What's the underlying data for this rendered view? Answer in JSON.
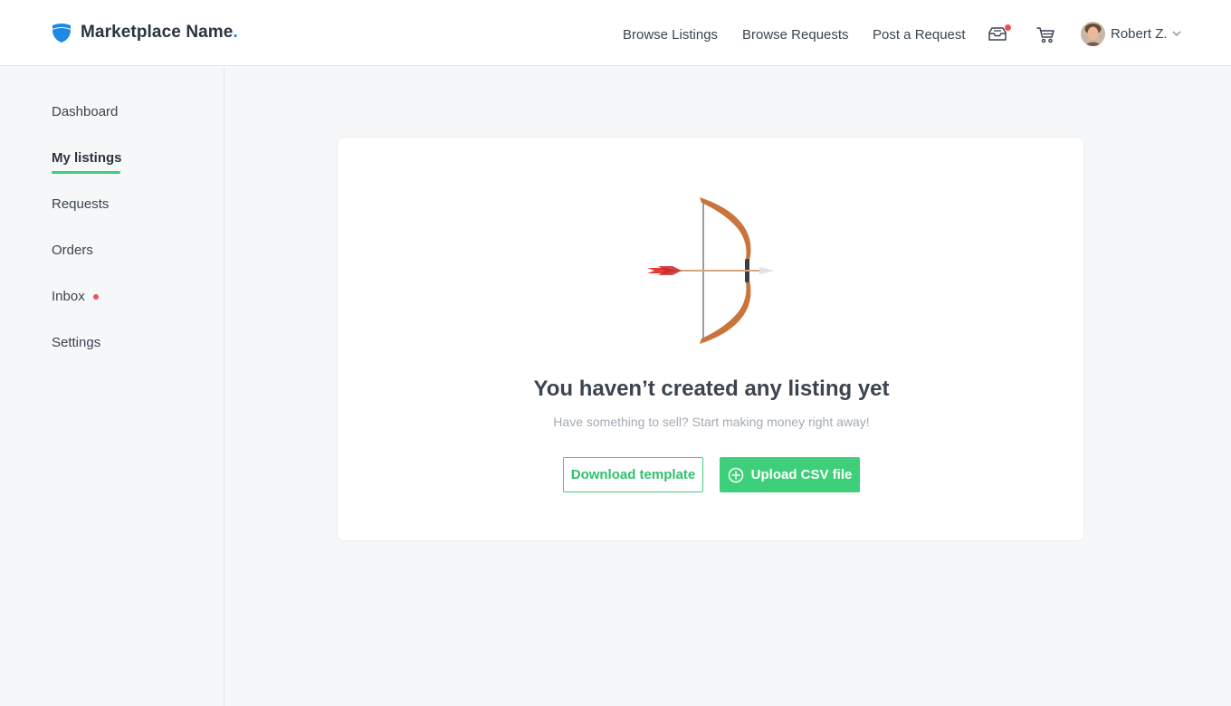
{
  "brand": {
    "name": "Marketplace Name",
    "dot": ".",
    "accent": "#1e88e5"
  },
  "nav": {
    "browse_listings": "Browse Listings",
    "browse_requests": "Browse Requests",
    "post_request": "Post a Request"
  },
  "icons": {
    "inbox": "inbox-tray-icon",
    "cart": "shopping-cart-icon",
    "chevron": "chevron-down-icon"
  },
  "user": {
    "name": "Robert Z."
  },
  "sidebar": {
    "items": [
      {
        "label": "Dashboard"
      },
      {
        "label": "My listings"
      },
      {
        "label": "Requests"
      },
      {
        "label": "Orders"
      },
      {
        "label": "Inbox"
      },
      {
        "label": "Settings"
      }
    ],
    "active_index": 1
  },
  "empty_state": {
    "title": "You haven’t created any listing yet",
    "subtitle": "Have something to sell? Start making money right away!",
    "download_label": "Download template",
    "upload_label": "Upload CSV file"
  },
  "colors": {
    "accent_green": "#3ecf7a",
    "notification_red": "#ef5350",
    "bow_wood": "#c8743a"
  }
}
